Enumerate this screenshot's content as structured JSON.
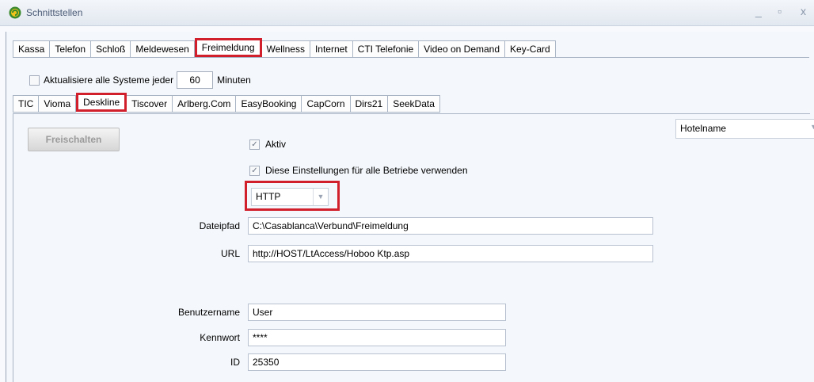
{
  "window": {
    "title": "Schnittstellen",
    "minimize": "_",
    "maximize": "▫",
    "close": "x"
  },
  "main_tabs": [
    "Kassa",
    "Telefon",
    "Schloß",
    "Meldewesen",
    "Freimeldung",
    "Wellness",
    "Internet",
    "CTI Telefonie",
    "Video on Demand",
    "Key-Card"
  ],
  "main_active": "Freimeldung",
  "update": {
    "label": "Aktualisiere alle Systeme jeder",
    "value": "60",
    "unit": "Minuten"
  },
  "sub_tabs": [
    "TIC",
    "Vioma",
    "Deskline",
    "Tiscover",
    "Arlberg.Com",
    "EasyBooking",
    "CapCorn",
    "Dirs21",
    "SeekData"
  ],
  "sub_active": "Deskline",
  "panel": {
    "unlock_label": "Freischalten",
    "hotel_select": "Hotelname",
    "aktiv_label": "Aktiv",
    "all_label": "Diese Einstellungen für alle Betriebe verwenden",
    "protocol": "HTTP",
    "check_mark": "✓",
    "dropdown_arrow": "▼",
    "fields": {
      "dateipfad": {
        "label": "Dateipfad",
        "value": "C:\\Casablanca\\Verbund\\Freimeldung"
      },
      "url": {
        "label": "URL",
        "value": "http://HOST/LtAccess/Hoboo Ktp.asp"
      },
      "benutzername": {
        "label": "Benutzername",
        "value": "User"
      },
      "kennwort": {
        "label": "Kennwort",
        "value": "****"
      },
      "id": {
        "label": "ID",
        "value": "25350"
      }
    }
  },
  "colors": {
    "highlight": "#d11f2c",
    "title_text": "#4a5a75",
    "disabled_text": "#9a9a9a"
  },
  "icons": {
    "app": "casablanca-logo-icon",
    "minimize": "minimize-icon",
    "maximize": "maximize-icon",
    "close": "close-icon"
  }
}
